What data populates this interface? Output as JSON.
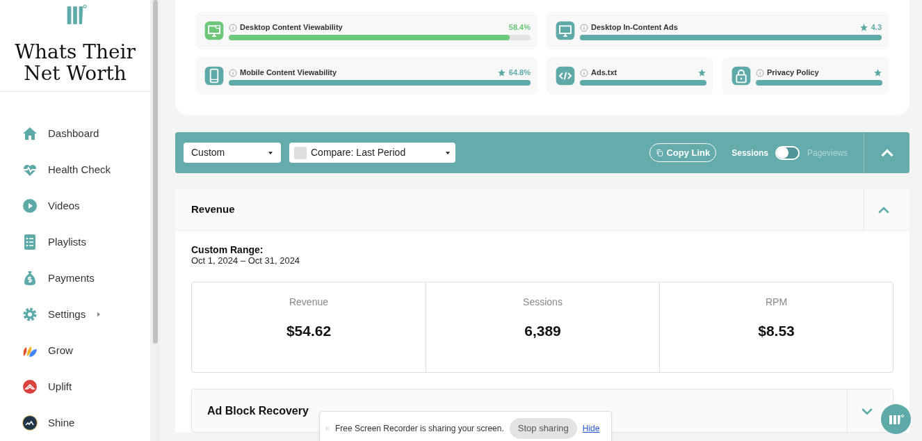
{
  "sidebar": {
    "brand": "Whats Their Net Worth",
    "items": [
      {
        "label": "Dashboard",
        "has_submenu": false
      },
      {
        "label": "Health Check",
        "has_submenu": false
      },
      {
        "label": "Videos",
        "has_submenu": false
      },
      {
        "label": "Playlists",
        "has_submenu": false
      },
      {
        "label": "Payments",
        "has_submenu": false
      },
      {
        "label": "Settings",
        "has_submenu": true
      },
      {
        "label": "Grow",
        "has_submenu": false
      },
      {
        "label": "Uplift",
        "has_submenu": false
      },
      {
        "label": "Shine",
        "has_submenu": false
      }
    ]
  },
  "health": {
    "rows": [
      [
        {
          "label": "Desktop Content Viewability",
          "reading": "58.4%",
          "starred": false,
          "level": 0.93,
          "color": "#6cc77a"
        },
        {
          "label": "Desktop In-Content Ads",
          "reading": "4.3",
          "starred": true,
          "level": 1,
          "color": "#5eaaa8"
        }
      ],
      [
        {
          "label": "Mobile Content Viewability",
          "reading": "64.8%",
          "starred": true,
          "level": 1,
          "color": "#5eaaa8"
        },
        {
          "label": "Ads.txt",
          "starred": true,
          "level": 1,
          "color": "#5eaaa8"
        },
        {
          "label": "Privacy Policy",
          "starred": true,
          "level": 1,
          "color": "#5eaaa8"
        }
      ]
    ]
  },
  "toolbar": {
    "range": "Custom",
    "compare": {
      "label": "Compare: Last Period",
      "checked": false
    },
    "copy_link": "Copy Link",
    "toggle": {
      "left": "Sessions",
      "right": "Pageviews",
      "on": false
    },
    "expanded": true
  },
  "sections": [
    {
      "title": "Revenue",
      "expanded": true,
      "range_label": "Custom Range:",
      "range": "Oct 1, 2024 – Oct 31, 2024",
      "stats": [
        {
          "label": "Revenue",
          "value": "$54.62"
        },
        {
          "label": "Sessions",
          "value": "6,389"
        },
        {
          "label": "RPM",
          "value": "$8.53"
        }
      ]
    },
    {
      "title": "Ad Block Recovery",
      "expanded": false
    }
  ],
  "share_bar": {
    "message": "Free Screen Recorder is sharing your screen.",
    "stop": "Stop sharing",
    "hide": "Hide"
  }
}
